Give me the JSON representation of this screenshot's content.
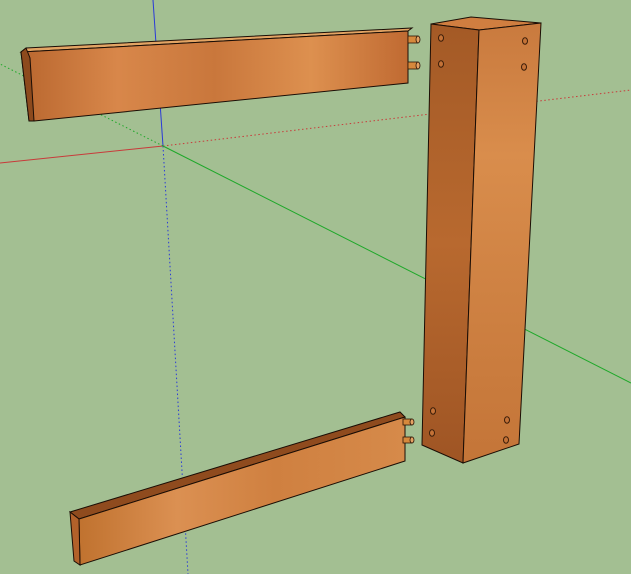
{
  "viewport": {
    "background": "#a3bf92"
  },
  "axes": {
    "x_color": "#c83a3a",
    "y_color": "#1fa82a",
    "z_color": "#2a3ad8"
  },
  "wood": {
    "front_face": "#c9733a",
    "front_face_light": "#de9450",
    "top_face": "#e09f60",
    "side_face": "#8d4a1d",
    "end_grain": "#c4702f",
    "edge": "#1a0d05"
  },
  "dowel_color": "#d6893c",
  "hole_color": "#4a2610",
  "components": [
    "top-rail",
    "leg-post",
    "bottom-rail"
  ]
}
